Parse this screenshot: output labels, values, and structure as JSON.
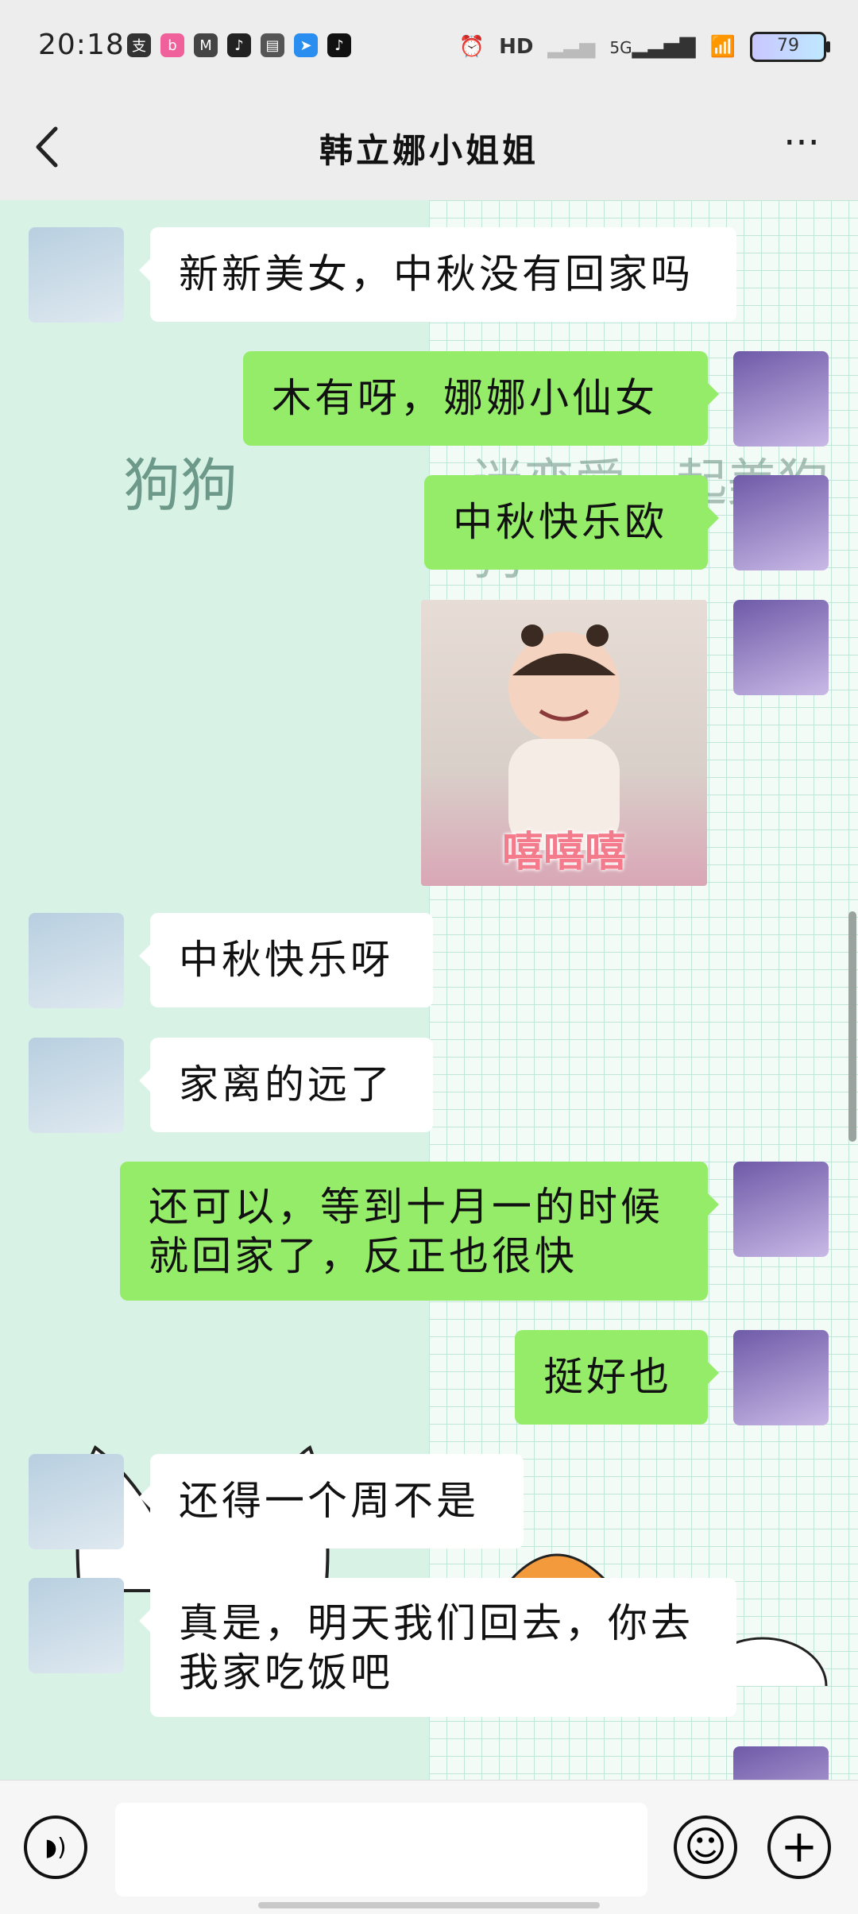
{
  "status_bar": {
    "time": "20:18",
    "app_icons": [
      "alipay-icon",
      "bilibili-icon",
      "maps-icon",
      "tiktok-icon",
      "book-icon",
      "telegram-icon",
      "tiktok-lite-icon"
    ],
    "alarm": "⏰",
    "hd": "HD",
    "network": "5G",
    "battery": "79"
  },
  "nav": {
    "title": "韩立娜小姐姐",
    "back_glyph": "<",
    "more_glyph": "···"
  },
  "background_text": {
    "left": "狗狗",
    "right": "迷恋爱一起美狗狗"
  },
  "messages": [
    {
      "side": "left",
      "text": "新新美女，中秋没有回家吗"
    },
    {
      "side": "right",
      "text": "木有呀，娜娜小仙女"
    },
    {
      "side": "right",
      "text": "中秋快乐欧"
    },
    {
      "side": "right",
      "type": "image",
      "caption": "嘻嘻嘻"
    },
    {
      "side": "left",
      "text": "中秋快乐呀"
    },
    {
      "side": "left",
      "text": "家离的远了"
    },
    {
      "side": "right",
      "text": "还可以，等到十月一的时候就回家了，反正也很快"
    },
    {
      "side": "right",
      "text": "挺好也"
    },
    {
      "side": "left",
      "text": "还得一个周不是"
    },
    {
      "side": "left",
      "text": "真是，明天我们回去，你去我家吃饭吧"
    }
  ],
  "input_bar": {
    "voice_glyph": "◗)",
    "emoji_glyph": "☺",
    "plus_glyph": "+"
  },
  "colors": {
    "sent_bubble": "#95ec69",
    "received_bubble": "#ffffff",
    "page_bg": "#ededed"
  }
}
